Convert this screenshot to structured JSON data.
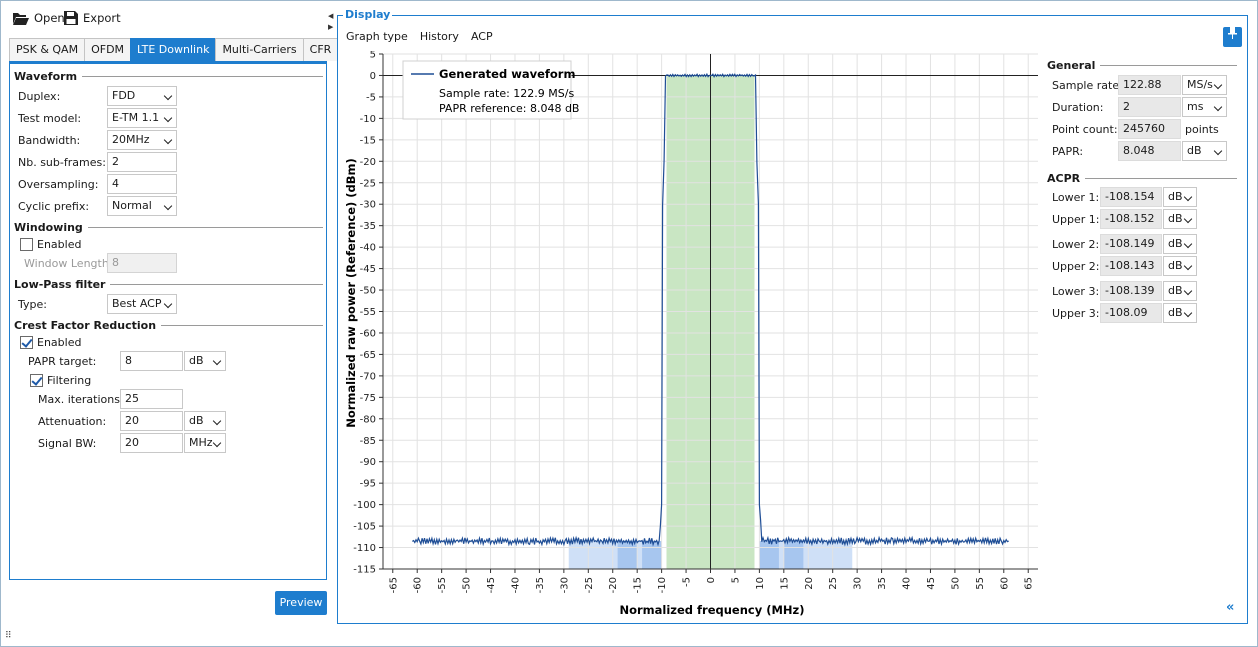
{
  "toolbar": {
    "open_label": "Open",
    "export_label": "Export"
  },
  "tabs": [
    "PSK & QAM",
    "OFDM",
    "LTE Downlink",
    "Multi-Carriers",
    "CFR"
  ],
  "active_tab": 2,
  "waveform": {
    "section": "Waveform",
    "duplex_label": "Duplex:",
    "duplex_value": "FDD",
    "test_model_label": "Test model:",
    "test_model_value": "E-TM 1.1",
    "bandwidth_label": "Bandwidth:",
    "bandwidth_value": "20MHz",
    "subframes_label": "Nb. sub-frames:",
    "subframes_value": "2",
    "oversampling_label": "Oversampling:",
    "oversampling_value": "4",
    "cyclic_label": "Cyclic prefix:",
    "cyclic_value": "Normal"
  },
  "windowing": {
    "section": "Windowing",
    "enabled_label": "Enabled",
    "enabled": false,
    "length_label": "Window Length:",
    "length_value": "8"
  },
  "lowpass": {
    "section": "Low-Pass filter",
    "type_label": "Type:",
    "type_value": "Best ACP"
  },
  "cfr": {
    "section": "Crest Factor Reduction",
    "enabled_label": "Enabled",
    "enabled": true,
    "papr_label": "PAPR target:",
    "papr_value": "8",
    "papr_unit": "dB",
    "filtering_label": "Filtering",
    "filtering": true,
    "iter_label": "Max. iterations:",
    "iter_value": "25",
    "atten_label": "Attenuation:",
    "atten_value": "20",
    "atten_unit": "dB",
    "bw_label": "Signal BW:",
    "bw_value": "20",
    "bw_unit": "MHz"
  },
  "preview_label": "Preview",
  "display": {
    "title": "Display",
    "menu": [
      "Graph type",
      "History",
      "ACP"
    ]
  },
  "general": {
    "section": "General",
    "sample_rate_label": "Sample rate:",
    "sample_rate_value": "122.88",
    "sample_rate_unit": "MS/s",
    "duration_label": "Duration:",
    "duration_value": "2",
    "duration_unit": "ms",
    "points_label": "Point count:",
    "points_value": "245760",
    "points_unit": "points",
    "papr_label": "PAPR:",
    "papr_value": "8.048",
    "papr_unit": "dB"
  },
  "acpr": {
    "section": "ACPR",
    "rows": [
      {
        "label": "Lower 1:",
        "value": "-108.154",
        "unit": "dB"
      },
      {
        "label": "Upper 1:",
        "value": "-108.152",
        "unit": "dB"
      },
      {
        "label": "Lower 2:",
        "value": "-108.149",
        "unit": "dB"
      },
      {
        "label": "Upper 2:",
        "value": "-108.143",
        "unit": "dB"
      },
      {
        "label": "Lower 3:",
        "value": "-108.139",
        "unit": "dB"
      },
      {
        "label": "Upper 3:",
        "value": "-108.09",
        "unit": "dB"
      }
    ]
  },
  "chart_data": {
    "type": "line",
    "xlabel": "Normalized frequency (MHz)",
    "ylabel": "Normalized raw power (Reference) (dBm)",
    "xlim": [
      -67,
      67
    ],
    "ylim": [
      -115,
      5
    ],
    "xticks": [
      -65,
      -60,
      -55,
      -50,
      -45,
      -40,
      -35,
      -30,
      -25,
      -20,
      -15,
      -10,
      -5,
      0,
      5,
      10,
      15,
      20,
      25,
      30,
      35,
      40,
      45,
      50,
      55,
      60,
      65
    ],
    "yticks": [
      5,
      0,
      -5,
      -10,
      -15,
      -20,
      -25,
      -30,
      -35,
      -40,
      -45,
      -50,
      -55,
      -60,
      -65,
      -70,
      -75,
      -80,
      -85,
      -90,
      -95,
      -100,
      -105,
      -110,
      -115
    ],
    "grid": true,
    "legend": {
      "title": "Generated waveform",
      "lines": [
        "Sample rate: 122.9 MS/s",
        "PAPR reference: 8.048 dB"
      ],
      "placement": "top-left"
    },
    "series": [
      {
        "name": "Generated waveform",
        "color": "#1f4e96",
        "x": [
          -61,
          -10.5,
          -10,
          -9.8,
          -9.5,
          -9.2,
          9.2,
          9.5,
          9.8,
          10,
          10.5,
          61
        ],
        "y": [
          -108.5,
          -108.5,
          -100,
          -30,
          -20,
          0,
          0,
          -20,
          -30,
          -100,
          -108.5,
          -108.5
        ]
      }
    ],
    "channel_band": {
      "x": [
        -9,
        9
      ],
      "color": "#c9e6c3"
    },
    "acp_bands": [
      {
        "x": [
          -29,
          -10
        ],
        "color": "#cfe0f7"
      },
      {
        "x": [
          10,
          29
        ],
        "color": "#cfe0f7"
      },
      {
        "x": [
          -19,
          -15
        ],
        "color": "#a7c6ef"
      },
      {
        "x": [
          15,
          19
        ],
        "color": "#a7c6ef"
      },
      {
        "x": [
          -14,
          -10
        ],
        "color": "#a7c6ef"
      },
      {
        "x": [
          10,
          14
        ],
        "color": "#a7c6ef"
      }
    ]
  }
}
